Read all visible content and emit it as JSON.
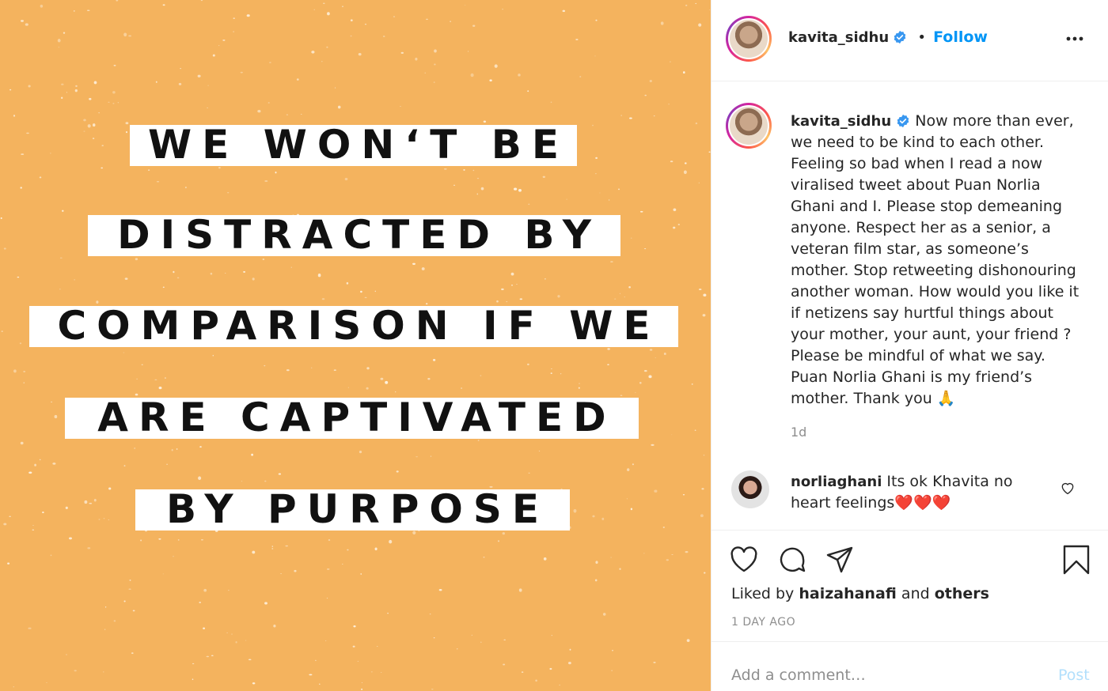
{
  "post_image": {
    "background_color": "#f4b35e",
    "quote_lines": [
      "WE WON‘T BE",
      "DISTRACTED BY",
      "COMPARISON IF WE",
      "ARE CAPTIVATED",
      "BY PURPOSE"
    ]
  },
  "header": {
    "username": "kavita_sidhu",
    "separator": "•",
    "follow_label": "Follow",
    "more_icon": "more-horizontal-icon"
  },
  "caption": {
    "username": "kavita_sidhu",
    "text": "Now more than ever, we need to be kind to each other. Feeling so bad when I read a now viralised tweet about Puan Norlia Ghani and I. Please stop demeaning anyone. Respect her as a senior, a veteran film star, as someone’s mother. Stop retweeting dishonouring another woman. How would you like it if netizens say hurtful things about your mother, your aunt, your friend ? Please be mindful of what we say. Puan Norlia Ghani is my friend’s mother. Thank you 🙏",
    "time": "1d"
  },
  "comments": [
    {
      "username": "norliaghani",
      "text": "Its ok Khavita no heart feelings❤️❤️❤️"
    }
  ],
  "actions": {
    "liked_by_prefix": "Liked by",
    "liked_by_user": "haizahanafi",
    "liked_by_and": "and",
    "liked_by_others": "others",
    "date": "1 DAY AGO"
  },
  "add_comment": {
    "placeholder": "Add a comment…",
    "post_label": "Post"
  },
  "colors": {
    "link": "#0095f6",
    "muted": "#8e8e8e",
    "post_disabled": "#b2dffc",
    "verified": "#3897f0"
  }
}
